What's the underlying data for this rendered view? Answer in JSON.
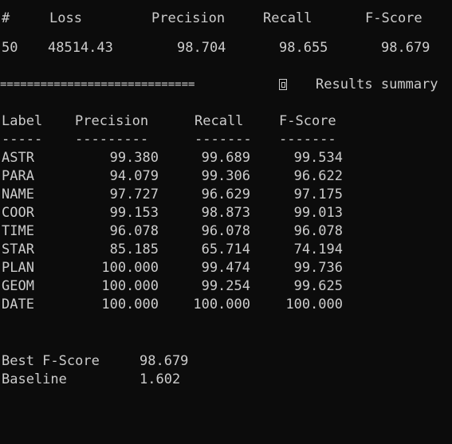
{
  "training_header": {
    "hash": "#",
    "loss": "Loss",
    "precision": "Precision",
    "recall": "Recall",
    "fscore": "F-Score"
  },
  "training_row": {
    "epoch": "50",
    "loss": "48514.43",
    "precision": "98.704",
    "recall": "98.655",
    "fscore": "98.679"
  },
  "summary_divider": {
    "rule": "=============================",
    "icon": "summary-icon",
    "title": "Results summary"
  },
  "results_table": {
    "headers": {
      "label": "Label",
      "precision": "Precision",
      "recall": "Recall",
      "fscore": "F-Score"
    },
    "underlines": {
      "label": "-----",
      "precision": "---------",
      "recall": "-------",
      "fscore": "-------"
    },
    "rows": [
      {
        "label": "ASTR",
        "precision": "99.380",
        "recall": "99.689",
        "fscore": "99.534"
      },
      {
        "label": "PARA",
        "precision": "94.079",
        "recall": "99.306",
        "fscore": "96.622"
      },
      {
        "label": "NAME",
        "precision": "97.727",
        "recall": "96.629",
        "fscore": "97.175"
      },
      {
        "label": "COOR",
        "precision": "99.153",
        "recall": "98.873",
        "fscore": "99.013"
      },
      {
        "label": "TIME",
        "precision": "96.078",
        "recall": "96.078",
        "fscore": "96.078"
      },
      {
        "label": "STAR",
        "precision": "85.185",
        "recall": "65.714",
        "fscore": "74.194"
      },
      {
        "label": "PLAN",
        "precision": "100.000",
        "recall": "99.474",
        "fscore": "99.736"
      },
      {
        "label": "GEOM",
        "precision": "100.000",
        "recall": "99.254",
        "fscore": "99.625"
      },
      {
        "label": "DATE",
        "precision": "100.000",
        "recall": "100.000",
        "fscore": "100.000"
      }
    ]
  },
  "summary": {
    "best_label": "Best F-Score",
    "best_value": "98.679",
    "baseline_label": "Baseline",
    "baseline_value": "1.602"
  }
}
